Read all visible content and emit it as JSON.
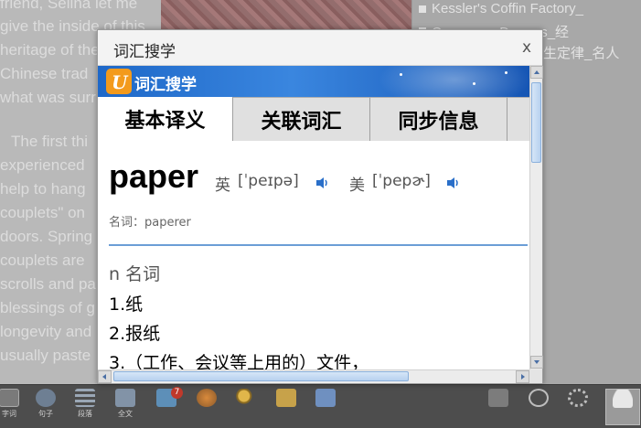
{
  "background": {
    "article_lines": [
      "friend, Selina let me",
      "give the inside of this",
      "heritage of the",
      "Chinese trad",
      "what was surr",
      "",
      "The first thi",
      "experienced",
      "help to hang",
      "couplets\" on",
      "doors. Spring",
      "couplets are",
      "scrolls and pa",
      "blessings of g",
      "longevity and",
      "usually paste"
    ],
    "sidebar_links": [
      "Kessler's Coffin Factory_",
      "Open your Dreams_经",
      "生定律_名人"
    ]
  },
  "toolbar": {
    "buttons": [
      {
        "icon": "text-icon",
        "label": "字词"
      },
      {
        "icon": "speech-bubble-icon",
        "label": "句子"
      },
      {
        "icon": "list-icon",
        "label": "段落"
      },
      {
        "icon": "fulltext-icon",
        "label": "全文"
      },
      {
        "icon": "gift-icon",
        "label": "",
        "badge": "7"
      },
      {
        "icon": "globe-icon",
        "label": ""
      },
      {
        "icon": "magnifier-icon",
        "label": ""
      },
      {
        "icon": "font-size-icon",
        "label": ""
      },
      {
        "icon": "speaker-icon",
        "label": ""
      },
      {
        "icon": "bookmark-icon",
        "label": ""
      },
      {
        "icon": "zoom-icon",
        "label": ""
      },
      {
        "icon": "gear-icon",
        "label": ""
      },
      {
        "icon": "user-icon",
        "label": ""
      }
    ]
  },
  "popup": {
    "title": "词汇搜学",
    "close_label": "x",
    "banner_title": "词汇搜学",
    "banner_logo_letter": "U",
    "tabs": [
      {
        "label": "基本译义",
        "active": true
      },
      {
        "label": "关联词汇",
        "active": false
      },
      {
        "label": "同步信息",
        "active": false
      }
    ],
    "entry": {
      "word": "paper",
      "uk_label": "英",
      "uk_phonetic": "[ˈpeɪpə]",
      "us_label": "美",
      "us_phonetic": "[ˈpepɚ]",
      "inflection": "名词：paperer",
      "part_of_speech": "n 名词",
      "definitions": [
        "1.纸",
        "2.报纸",
        "3.（工作、会议等上用的）文件，"
      ]
    }
  },
  "colors": {
    "banner": "#2a74d4",
    "accent_divider": "#6b9ed6",
    "logo_orange": "#f39a1c",
    "scroll_thumb": "#b7d1ef"
  }
}
